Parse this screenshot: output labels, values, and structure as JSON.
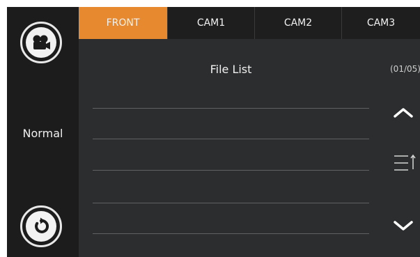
{
  "tabs": [
    {
      "label": "FRONT",
      "active": true
    },
    {
      "label": "CAM1",
      "active": false
    },
    {
      "label": "CAM2",
      "active": false
    },
    {
      "label": "CAM3",
      "active": false
    }
  ],
  "sidebar": {
    "mode_label": "Normal",
    "top_icon": "video-camera-icon",
    "bottom_icon": "refresh-icon"
  },
  "file_list": {
    "title": "File List",
    "page_indicator": "(01/05)",
    "rows": [
      "",
      "",
      "",
      "",
      ""
    ]
  },
  "controls": {
    "up_icon": "chevron-up-icon",
    "sort_icon": "sort-list-icon",
    "down_icon": "chevron-down-icon"
  },
  "colors": {
    "accent": "#e7892f",
    "background": "#2b2d2e",
    "sidebar": "#1c1c1c"
  }
}
